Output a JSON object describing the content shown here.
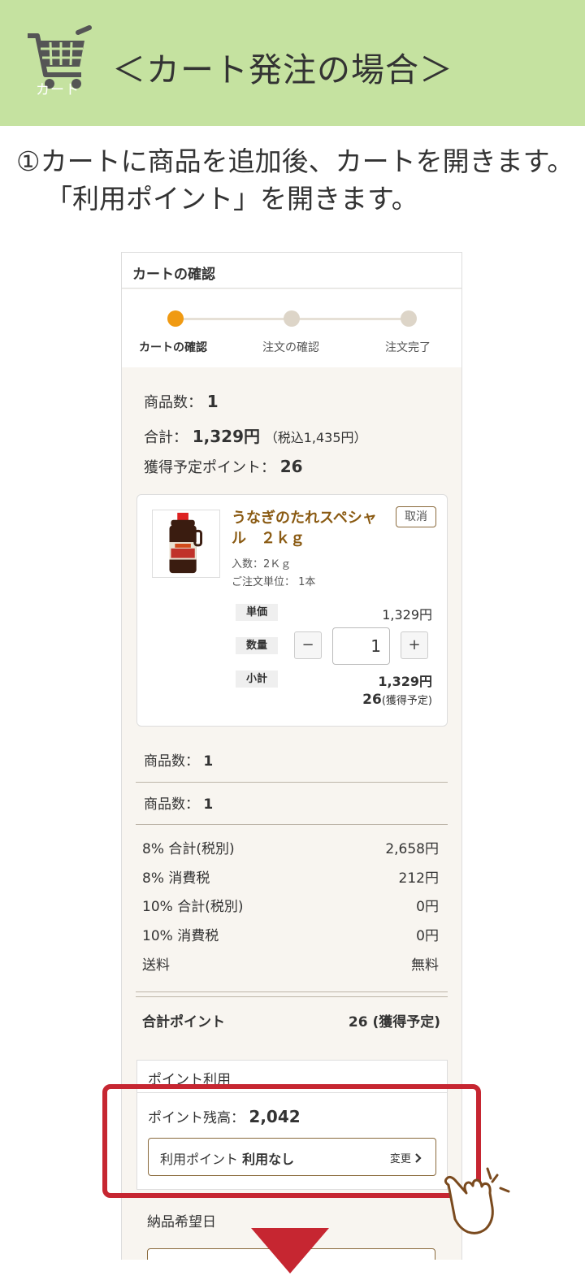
{
  "banner": {
    "cart_icon_label": "カート",
    "title": "＜カート発注の場合＞",
    "color": "#c5e2a0"
  },
  "instruction": {
    "line1": "①カートに商品を追加後、カートを開きます。",
    "line2": "「利用ポイント」を開きます。"
  },
  "screen": {
    "header_title": "カートの確認",
    "steps": [
      {
        "label": "カートの確認",
        "active": true
      },
      {
        "label": "注文の確認",
        "active": false
      },
      {
        "label": "注文完了",
        "active": false
      }
    ],
    "summary_top": {
      "item_count_label": "商品数：",
      "item_count": "1",
      "total_label": "合計：",
      "total": "1,329円",
      "total_tax": "（税込1,435円）",
      "points_label": "獲得予定ポイント：",
      "points": "26"
    },
    "product": {
      "name": "うなぎのたれスペシャル　２ｋｇ",
      "cancel_label": "取消",
      "content_label": "入数：2Ｋｇ",
      "unit_label": "ご注文単位： 1本",
      "unit_price_tag": "単価",
      "unit_price": "1,329円",
      "qty_tag": "数量",
      "minus": "−",
      "qty": "1",
      "plus": "+",
      "subtotal_tag": "小計",
      "subtotal": "1,329円",
      "points": "26",
      "points_note": "(獲得予定)"
    },
    "item_count_row1": {
      "label": "商品数：",
      "value": "1"
    },
    "item_count_row2": {
      "label": "商品数：",
      "value": "1"
    },
    "breakdown": [
      {
        "label": "8% 合計(税別)",
        "value": "2,658円"
      },
      {
        "label": "8% 消費税",
        "value": "212円"
      },
      {
        "label": "10% 合計(税別)",
        "value": "0円"
      },
      {
        "label": "10% 消費税",
        "value": "0円"
      },
      {
        "label": "送料",
        "value": "無料"
      }
    ],
    "total_points": {
      "label": "合計ポイント",
      "value": "26 (獲得予定)"
    },
    "point_use": {
      "title": "ポイント利用",
      "balance_label": "ポイント残高：",
      "balance": "2,042",
      "use_label": "利用ポイント",
      "use_value": "利用なし",
      "change_label": "変更"
    },
    "delivery": {
      "title": "納品希望日"
    }
  },
  "colors": {
    "accent_orange": "#f09a12",
    "highlight_red": "#c62631",
    "brand_brown": "#8a5a12"
  },
  "icons": [
    "cart-icon",
    "hand-pointer-icon",
    "down-arrow-icon",
    "chevron-right-icon"
  ]
}
